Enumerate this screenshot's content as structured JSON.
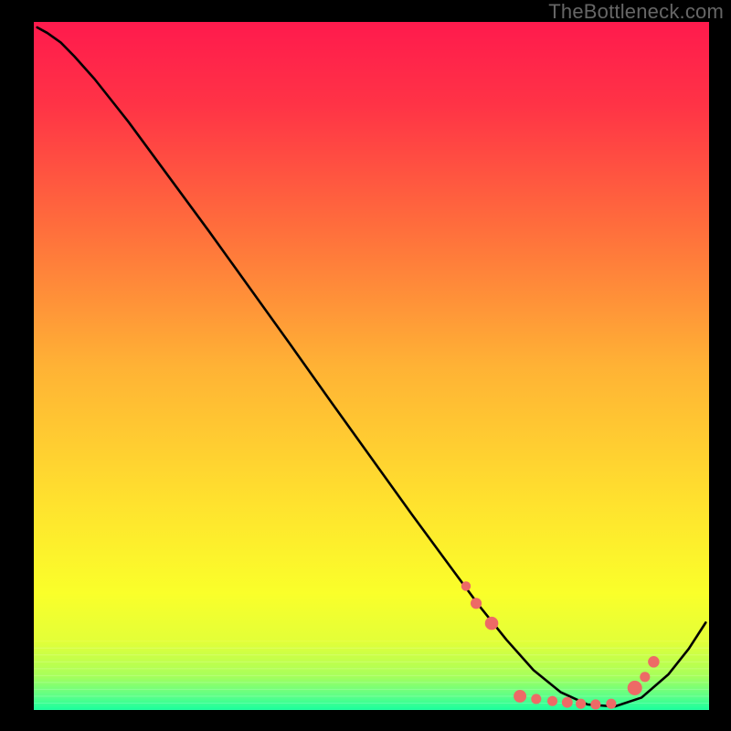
{
  "watermark": "TheBottleneck.com",
  "chart_data": {
    "type": "line",
    "title": "",
    "xlabel": "",
    "ylabel": "",
    "xlim": [
      0,
      100
    ],
    "ylim": [
      0,
      100
    ],
    "grid": false,
    "curve": {
      "x": [
        0.5,
        2.0,
        4.0,
        6.0,
        9.0,
        14.0,
        20.0,
        26.0,
        32.0,
        38.0,
        44.0,
        50.0,
        56.0,
        62.0,
        66.0,
        70.0,
        74.0,
        78.0,
        82.0,
        86.0,
        90.0,
        94.0,
        97.0,
        99.5
      ],
      "y": [
        99.2,
        98.4,
        97.0,
        95.0,
        91.7,
        85.5,
        77.5,
        69.5,
        61.3,
        53.1,
        44.8,
        36.6,
        28.4,
        20.4,
        15.1,
        10.2,
        5.8,
        2.6,
        0.8,
        0.5,
        1.8,
        5.2,
        8.9,
        12.7
      ]
    },
    "markers": {
      "color": "#ed6a66",
      "points": [
        {
          "x": 64.0,
          "y": 18.0,
          "r": 3.0
        },
        {
          "x": 65.5,
          "y": 15.5,
          "r": 3.5
        },
        {
          "x": 67.8,
          "y": 12.6,
          "r": 4.2
        },
        {
          "x": 72.0,
          "y": 2.0,
          "r": 4.0
        },
        {
          "x": 74.4,
          "y": 1.6,
          "r": 3.2
        },
        {
          "x": 76.8,
          "y": 1.3,
          "r": 3.2
        },
        {
          "x": 79.0,
          "y": 1.1,
          "r": 3.4
        },
        {
          "x": 81.0,
          "y": 0.9,
          "r": 3.2
        },
        {
          "x": 83.2,
          "y": 0.8,
          "r": 3.2
        },
        {
          "x": 85.5,
          "y": 0.9,
          "r": 3.2
        },
        {
          "x": 89.0,
          "y": 3.2,
          "r": 4.6
        },
        {
          "x": 90.5,
          "y": 4.8,
          "r": 3.2
        },
        {
          "x": 91.8,
          "y": 7.0,
          "r": 3.6
        }
      ]
    },
    "background": {
      "gradient_stops": [
        {
          "offset": 0.0,
          "color": "#ff1a4d"
        },
        {
          "offset": 0.12,
          "color": "#ff3346"
        },
        {
          "offset": 0.3,
          "color": "#ff6e3c"
        },
        {
          "offset": 0.5,
          "color": "#ffb235"
        },
        {
          "offset": 0.7,
          "color": "#ffe22e"
        },
        {
          "offset": 0.83,
          "color": "#faff2a"
        },
        {
          "offset": 0.9,
          "color": "#e3ff38"
        },
        {
          "offset": 0.95,
          "color": "#a8ff5a"
        },
        {
          "offset": 0.98,
          "color": "#5cff88"
        },
        {
          "offset": 1.0,
          "color": "#1aff9d"
        }
      ],
      "low_band": {
        "y_from": 0.0,
        "y_to": 10.0,
        "stripes": 10
      }
    }
  }
}
